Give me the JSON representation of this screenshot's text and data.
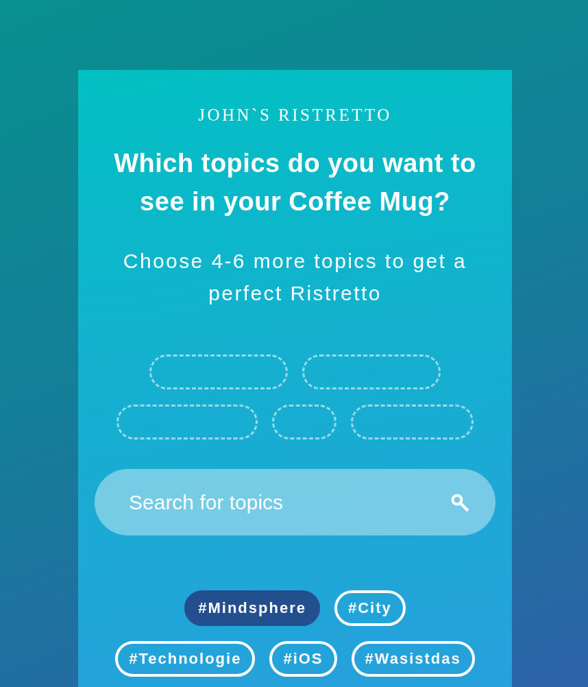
{
  "card": {
    "brand": "JOHN`S RISTRETTO",
    "title": "Which topics do you want to see in your Coffee Mug?",
    "subtitle": "Choose 4-6 more topics to get a perfect Ristretto"
  },
  "slots": [
    {
      "filled": false
    },
    {
      "filled": false
    },
    {
      "filled": false
    },
    {
      "filled": false
    },
    {
      "filled": false
    }
  ],
  "search": {
    "placeholder": "Search for topics"
  },
  "topics": [
    {
      "label": "#Mindsphere",
      "selected": true
    },
    {
      "label": "#City",
      "selected": false
    },
    {
      "label": "#Technologie",
      "selected": false
    },
    {
      "label": "#iOS",
      "selected": false
    },
    {
      "label": "#Wasistdas",
      "selected": false
    }
  ]
}
